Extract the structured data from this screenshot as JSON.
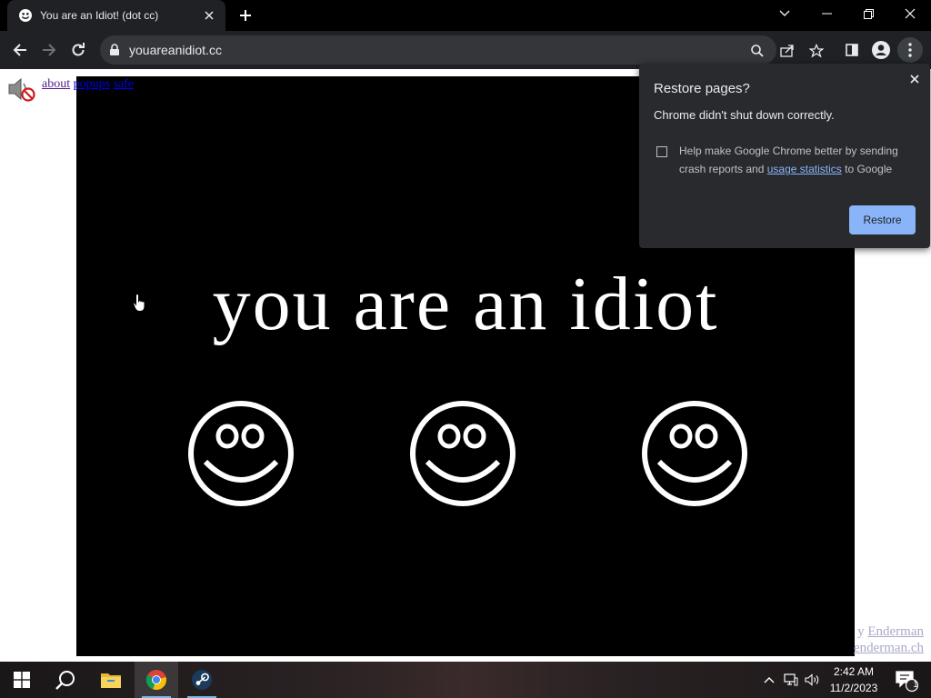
{
  "browser": {
    "tab_title": "You are an Idiot! (dot cc)",
    "url": "youareanidiot.cc"
  },
  "page": {
    "links": [
      "about",
      "popups",
      "safe"
    ],
    "headline": "you are an idiot",
    "credit_line1_prefix": "y",
    "credit_line1_link": "Enderman",
    "credit_line2_link": "enderman.ch"
  },
  "popup": {
    "title": "Restore pages?",
    "message": "Chrome didn't shut down correctly.",
    "help_prefix": "Help make Google Chrome better by sending crash reports and",
    "help_link": "usage statistics",
    "help_suffix": "to Google",
    "restore_label": "Restore",
    "checkbox_checked": false
  },
  "taskbar": {
    "time": "2:42 AM",
    "date": "11/2/2023",
    "notification_count": "1"
  },
  "colors": {
    "accent": "#8ab4f8",
    "toolbar": "#202124",
    "popup_bg": "#292a2d"
  }
}
